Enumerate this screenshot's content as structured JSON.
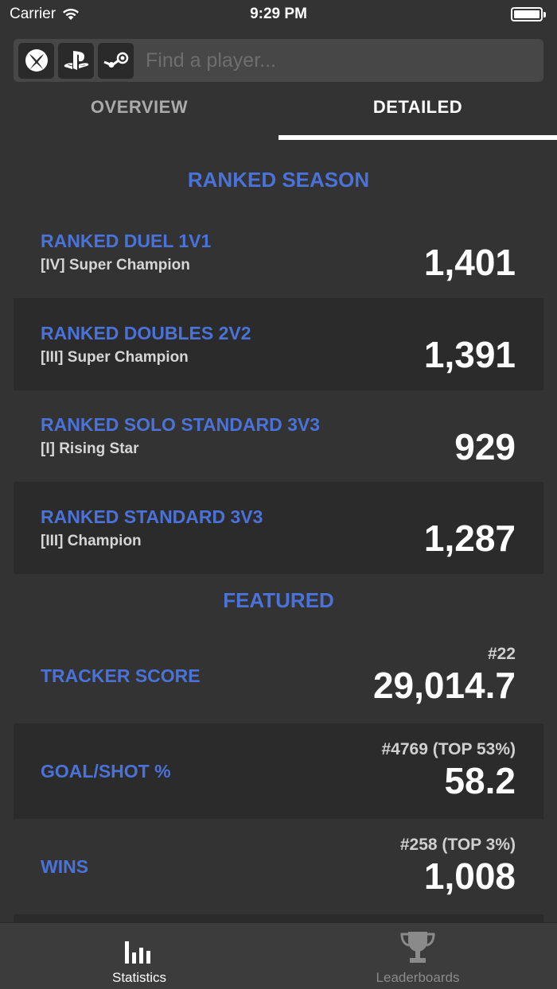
{
  "status_bar": {
    "carrier": "Carrier",
    "time": "9:29 PM"
  },
  "search": {
    "placeholder": "Find a player..."
  },
  "platforms": [
    "xbox-icon",
    "playstation-icon",
    "steam-icon"
  ],
  "tabs": {
    "overview": "OVERVIEW",
    "detailed": "DETAILED",
    "active": "detailed"
  },
  "ranked": {
    "title": "RANKED SEASON",
    "rows": [
      {
        "name": "RANKED DUEL 1V1",
        "rank": "[IV] Super Champion",
        "rating": "1,401"
      },
      {
        "name": "RANKED DOUBLES 2V2",
        "rank": "[III] Super Champion",
        "rating": "1,391"
      },
      {
        "name": "RANKED SOLO STANDARD 3V3",
        "rank": "[I] Rising Star",
        "rating": "929"
      },
      {
        "name": "RANKED STANDARD 3V3",
        "rank": "[III] Champion",
        "rating": "1,287"
      }
    ]
  },
  "featured": {
    "title": "FEATURED",
    "rows": [
      {
        "name": "TRACKER SCORE",
        "position": "#22",
        "value": "29,014.7"
      },
      {
        "name": "GOAL/SHOT %",
        "position": "#4769 (TOP 53%)",
        "value": "58.2"
      },
      {
        "name": "WINS",
        "position": "#258 (TOP 3%)",
        "value": "1,008"
      }
    ]
  },
  "tabbar": {
    "statistics": "Statistics",
    "leaderboards": "Leaderboards"
  },
  "colors": {
    "accent": "#4a72d8",
    "background": "#333333",
    "row_alt": "#2b2b2b"
  }
}
